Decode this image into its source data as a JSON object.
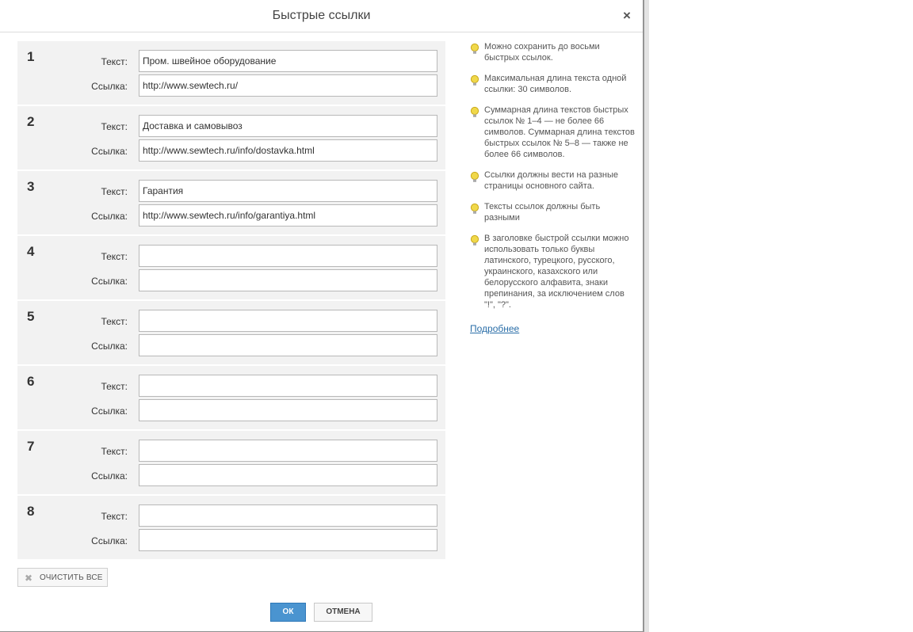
{
  "dialog": {
    "title": "Быстрые ссылки",
    "close_glyph": "×",
    "text_label": "Текст:",
    "link_label": "Ссылка:"
  },
  "links": [
    {
      "num": "1",
      "text": "Пром. швейное оборудование",
      "url": "http://www.sewtech.ru/"
    },
    {
      "num": "2",
      "text": "Доставка и самовывоз",
      "url": "http://www.sewtech.ru/info/dostavka.html"
    },
    {
      "num": "3",
      "text": "Гарантия",
      "url": "http://www.sewtech.ru/info/garantiya.html"
    },
    {
      "num": "4",
      "text": "",
      "url": ""
    },
    {
      "num": "5",
      "text": "",
      "url": ""
    },
    {
      "num": "6",
      "text": "",
      "url": ""
    },
    {
      "num": "7",
      "text": "",
      "url": ""
    },
    {
      "num": "8",
      "text": "",
      "url": ""
    }
  ],
  "hints": [
    {
      "text": "Можно сохранить до восьми быстрых ссылок.",
      "icon": "lightbulb-icon"
    },
    {
      "text": "Максимальная длина текста одной ссылки: 30 символов.",
      "icon": "lightbulb-icon"
    },
    {
      "text": "Суммарная длина текстов быстрых ссылок № 1–4 — не более 66 символов. Суммарная длина текстов быстрых ссылок № 5–8 — также не более 66 символов.",
      "icon": "lightbulb-icon"
    },
    {
      "text": "Ссылки должны вести на разные страницы основного сайта.",
      "icon": "lightbulb-icon"
    },
    {
      "text": "Тексты ссылок должны быть разными",
      "icon": "lightbulb-icon"
    },
    {
      "text": "В заголовке быстрой ссылки можно использовать только буквы латинского, турецкого, русского, украинского, казахского или белорусского алфавита, знаки препинания, за исключением слов \"!\", \"?\".",
      "icon": "lightbulb-icon"
    }
  ],
  "more_link": "Подробнее",
  "buttons": {
    "clear_all": "ОЧИСТИТЬ ВСЕ",
    "ok": "ОК",
    "cancel": "ОТМЕНА"
  },
  "colors": {
    "ok_button": "#4a94d0",
    "link": "#2a6ea8",
    "block_bg": "#f2f2f2",
    "hint_icon": "#f0d84a"
  }
}
